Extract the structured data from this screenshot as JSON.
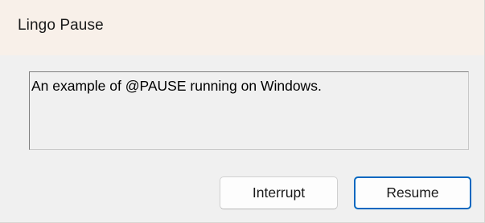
{
  "window": {
    "title": "Lingo Pause"
  },
  "message": {
    "text": "An example of @PAUSE running on Windows."
  },
  "buttons": {
    "interrupt_label": "Interrupt",
    "resume_label": "Resume"
  },
  "colors": {
    "titlebar_bg": "#f8f0e9",
    "client_bg": "#f0f0f0",
    "default_button_border": "#0067c0"
  }
}
